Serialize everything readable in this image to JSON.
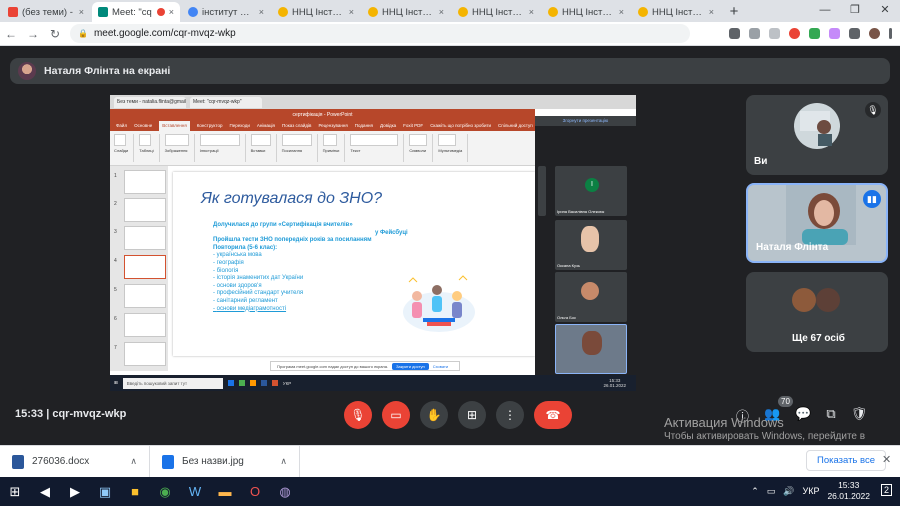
{
  "browser": {
    "tabs": [
      {
        "label": "(без теми) - ",
        "color": "#ea4335"
      },
      {
        "label": "Meet: \"cq",
        "color": "#00897b"
      },
      {
        "label": "інститут біол",
        "color": "#4285f4"
      },
      {
        "label": "ННЦ Інститу",
        "color": "#f4b400"
      },
      {
        "label": "ННЦ Інститу",
        "color": "#f4b400"
      },
      {
        "label": "ННЦ Інститу",
        "color": "#f4b400"
      },
      {
        "label": "ННЦ Інститу",
        "color": "#f4b400"
      },
      {
        "label": "ННЦ Інститу",
        "color": "#f4b400"
      }
    ],
    "tab_close": "×",
    "new_tab": "+",
    "url": "meet.google.com/cqr-mvqz-wkp",
    "window_min": "—",
    "window_max": "❐",
    "window_close": "✕"
  },
  "meet": {
    "presenting_text": "Наталя Флінта на екрані",
    "time": "15:33",
    "meeting_code": "cqr-mvqz-wkp",
    "participants_badge": "70",
    "tiles": [
      {
        "name": "Ви"
      },
      {
        "name": "Наталя Флінта"
      },
      {
        "name": "Ще 67 осіб"
      }
    ]
  },
  "shared_screen": {
    "inner_tabs": [
      "Без теми - natalia.flinta@gmail",
      "Meet: \"cqr-mvqz-wkp\""
    ],
    "ppt_title": "сертифікація - PowerPoint",
    "ppt_menu": [
      "Файл",
      "Основне",
      "Вставлення",
      "Конструктор",
      "Переходи",
      "Анімація",
      "Показ слайдів",
      "Рецензування",
      "Подання",
      "Довідка",
      "Foxit PDF",
      "Скажіть що потрібно зробити",
      "Спільний доступ"
    ],
    "ribbon_groups": [
      "Слайди",
      "Таблиці",
      "Зображення",
      "Ілюстрації",
      "Вставки",
      "Посилання",
      "Примітки",
      "Текст",
      "Символи",
      "Мультимедіа"
    ],
    "slide_title": "Як готувалася до ЗНО?",
    "slide_line1": "Долучилася до групи «Сертифікація вчителів»",
    "slide_line2": "у Фейсбуці",
    "slide_line3": "Пройшла тести ЗНО попередніх років за посиланням",
    "slide_line4": "Повторила (5-6 клас):",
    "slide_list": [
      "українська мова",
      "географія",
      "біологія",
      "історія знаменитих дат України",
      "основи здоров'я",
      "професійний стандарт учителя",
      "санітарний регламент",
      "основи медіаграмотності"
    ],
    "panel_header": "Згорнути презентацію",
    "mini_tiles": [
      "Ірина Василівна Олексюк",
      "Оксана Кузь",
      "Ольга Бос"
    ],
    "share_note": "Програма meet.google.com надає доступ до вашого екрана.",
    "share_stop": "Закрити доступ",
    "share_hide": "Сховати",
    "search_placeholder": "Введіть пошуковий запит тут",
    "inner_time": "15:33",
    "inner_date": "26.01.2022",
    "inner_lang": "УКР"
  },
  "activation": {
    "title": "Активация Windows",
    "subtitle": "Чтобы активировать Windows, перейдите в раздел \"Параметры\"."
  },
  "downloads": {
    "items": [
      {
        "name": "276036.docx",
        "color": "#2b579a"
      },
      {
        "name": "Без назви.jpg",
        "color": "#1a73e8"
      }
    ],
    "show_all": "Показать все",
    "close": "✕"
  },
  "taskbar": {
    "lang": "УКР",
    "time": "15:33",
    "date": "26.01.2022",
    "notifications": "2"
  }
}
